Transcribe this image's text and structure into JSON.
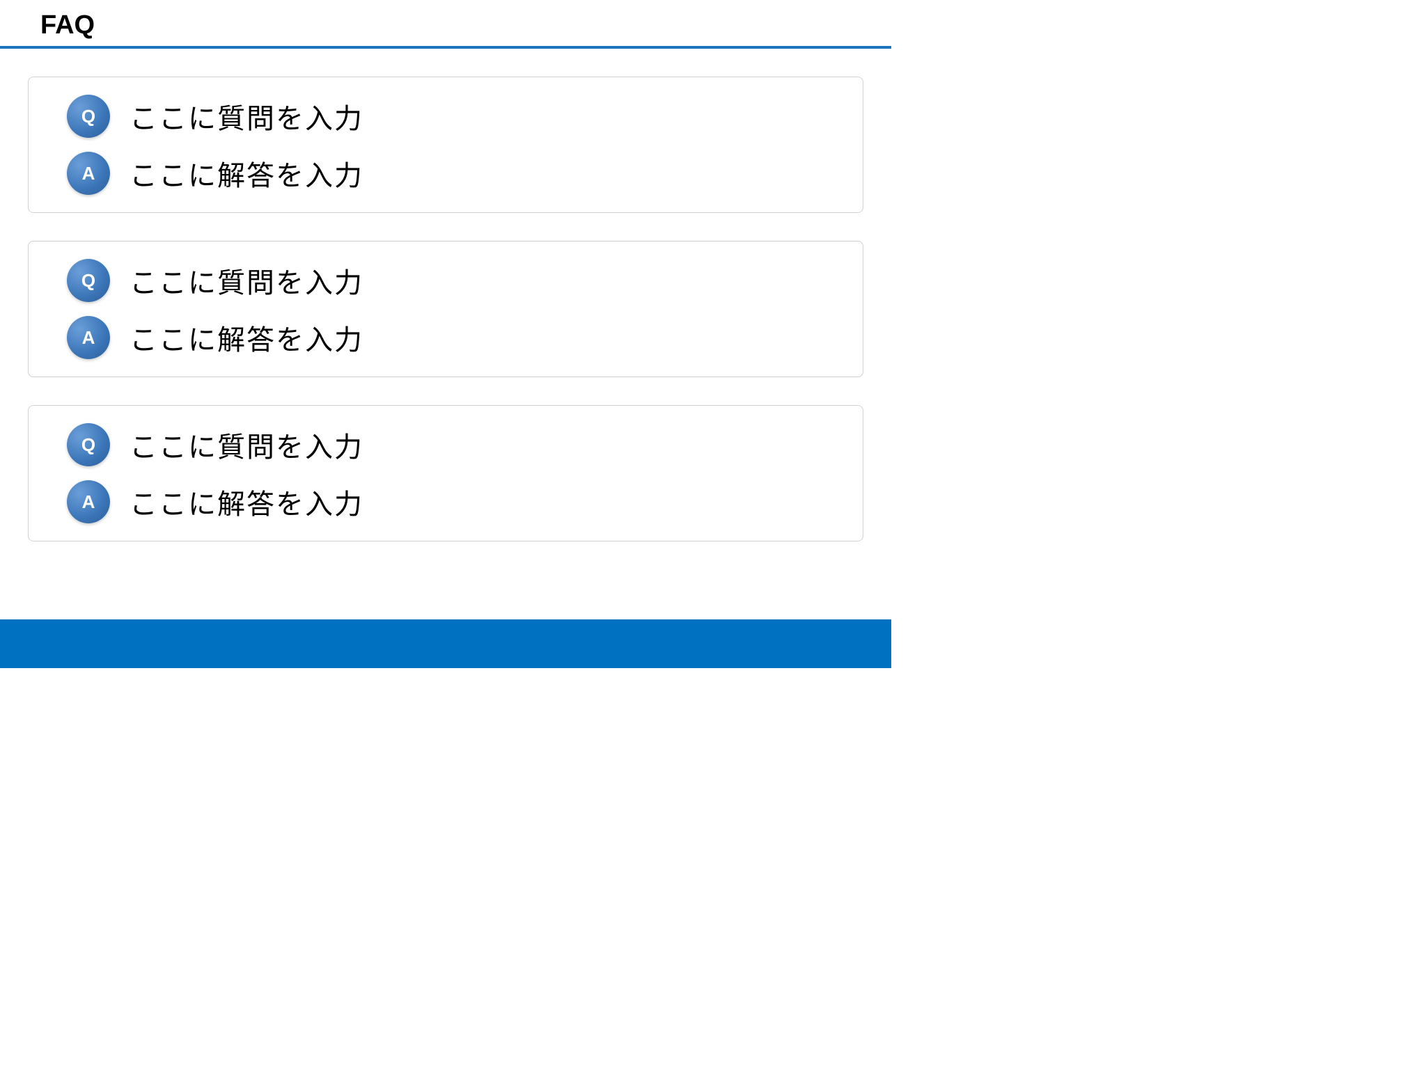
{
  "title": "FAQ",
  "badges": {
    "question": "Q",
    "answer": "A"
  },
  "items": [
    {
      "question": "ここに質問を入力",
      "answer": "ここに解答を入力"
    },
    {
      "question": "ここに質問を入力",
      "answer": "ここに解答を入力"
    },
    {
      "question": "ここに質問を入力",
      "answer": "ここに解答を入力"
    }
  ]
}
